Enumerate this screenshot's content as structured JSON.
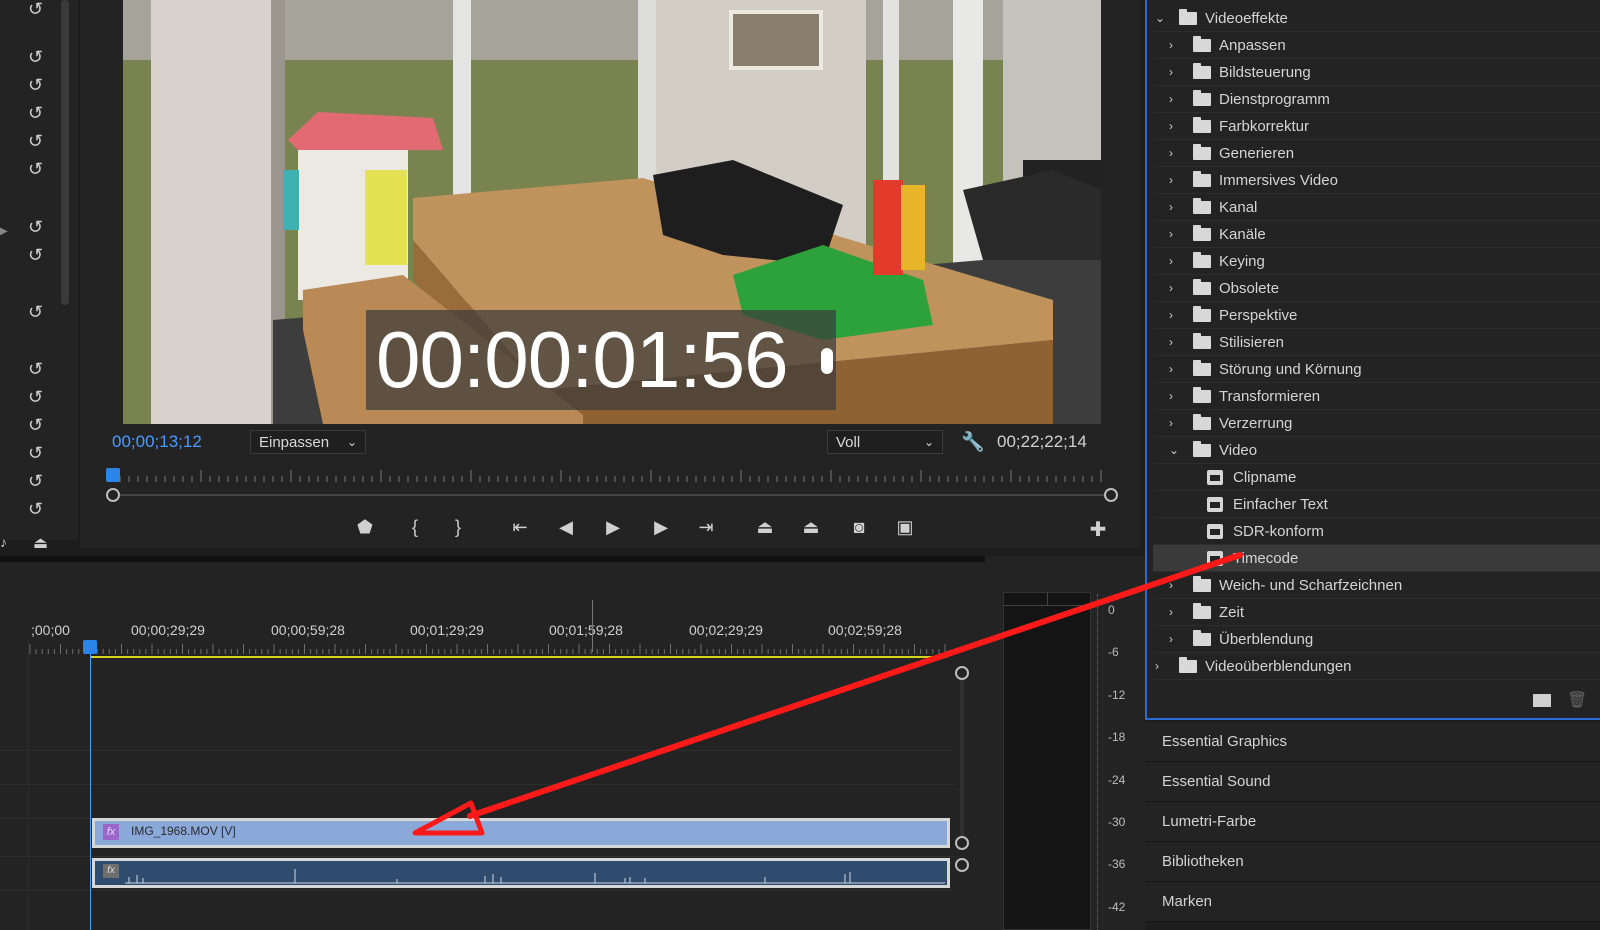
{
  "monitor": {
    "current_time": "00;00;13;12",
    "fit_dropdown": "Einpassen",
    "quality_dropdown": "Voll",
    "duration": "00;22;22;14",
    "overlay_timecode": "00:00:01:56"
  },
  "timeline": {
    "time_labels": [
      ";00;00",
      "00;00;29;29",
      "00;00;59;28",
      "00;01;29;29",
      "00;01;59;28",
      "00;02;29;29",
      "00;02;59;28"
    ],
    "video_clip_name": "IMG_1968.MOV [V]",
    "fx_badge": "fx"
  },
  "meter": {
    "db_labels": [
      "0",
      "-6",
      "-12",
      "-18",
      "-24",
      "-30",
      "-36",
      "-42"
    ]
  },
  "effects": {
    "root": "Videoeffekte",
    "folders": [
      "Anpassen",
      "Bildsteuerung",
      "Dienstprogramm",
      "Farbkorrektur",
      "Generieren",
      "Immersives Video",
      "Kanal",
      "Kanäle",
      "Keying",
      "Obsolete",
      "Perspektive",
      "Stilisieren",
      "Störung und Körnung",
      "Transformieren",
      "Verzerrung"
    ],
    "open_folder": "Video",
    "video_items": [
      "Clipname",
      "Einfacher Text",
      "SDR-konform",
      "Timecode"
    ],
    "selected_item": "Timecode",
    "folders_after": [
      "Weich- und Scharfzeichnen",
      "Zeit",
      "Überblendung"
    ],
    "root2": "Videoüberblendungen"
  },
  "panels": [
    "Essential Graphics",
    "Essential Sound",
    "Lumetri-Farbe",
    "Bibliotheken",
    "Marken"
  ],
  "icons": {
    "undo": "undo-icon",
    "folder": "folder-icon",
    "preset": "preset-icon",
    "wrench": "wrench-icon",
    "play": "play-icon",
    "camera": "camera-icon"
  },
  "colors": {
    "accent_blue": "#2b6bd8",
    "playhead": "#2a85e8",
    "annotation_arrow": "#ff1a1a",
    "video_clip": "#8aa9d9"
  }
}
